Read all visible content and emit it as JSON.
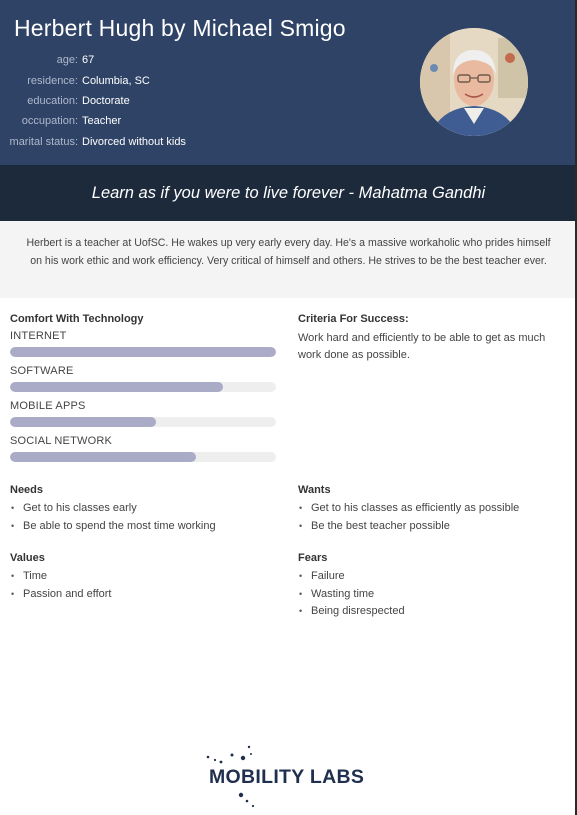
{
  "header": {
    "title": "Herbert Hugh by Michael Smigo",
    "facts": [
      {
        "label": "age:",
        "value": "67"
      },
      {
        "label": "residence:",
        "value": "Columbia, SC"
      },
      {
        "label": "education:",
        "value": "Doctorate"
      },
      {
        "label": "occupation:",
        "value": "Teacher"
      },
      {
        "label": "marital status:",
        "value": "Divorced without kids"
      }
    ]
  },
  "quote": "Learn as if you were to live forever - Mahatma Gandhi",
  "bio": "Herbert is a teacher at UofSC. He wakes up very early every day. He's a massive workaholic who prides himself on his work ethic and work efficiency. Very critical of himself and others. He strives to be the best teacher ever.",
  "technology": {
    "title": "Comfort With Technology",
    "items": [
      {
        "label": "INTERNET",
        "level": 1.0
      },
      {
        "label": "SOFTWARE",
        "level": 0.8
      },
      {
        "label": "MOBILE APPS",
        "level": 0.55
      },
      {
        "label": "SOCIAL NETWORK",
        "level": 0.7
      }
    ],
    "bar_color": "#a9abc7",
    "track_color": "#eeeeee"
  },
  "criteria": {
    "title": "Criteria For Success:",
    "text": "Work hard and efficiently to be able to get as much work done as possible."
  },
  "needs": {
    "title": "Needs",
    "items": [
      "Get to his classes early",
      "Be able to spend the most time working"
    ]
  },
  "wants": {
    "title": "Wants",
    "items": [
      "Get to his classes as efficiently as possible",
      "Be the best teacher possible"
    ]
  },
  "values": {
    "title": "Values",
    "items": [
      "Time",
      "Passion and effort"
    ]
  },
  "fears": {
    "title": "Fears",
    "items": [
      "Failure",
      "Wasting time",
      "Being disrespected"
    ]
  },
  "logo": {
    "text": "MOBILITY LABS"
  },
  "colors": {
    "header": "#2f4366",
    "quote_bar": "#1d2a3c",
    "bio_background": "#f4f4f4"
  }
}
